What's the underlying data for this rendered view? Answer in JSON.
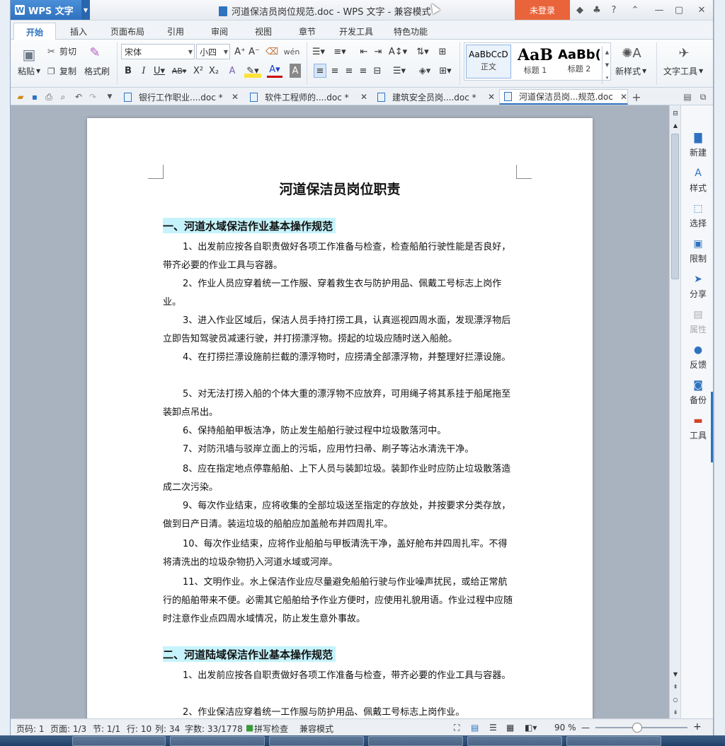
{
  "app": {
    "name": "WPS 文字",
    "doc_title": "河道保洁员岗位规范.doc - WPS 文字 - 兼容模式",
    "login": "未登录"
  },
  "ribbon_tabs": [
    "开始",
    "插入",
    "页面布局",
    "引用",
    "审阅",
    "视图",
    "章节",
    "开发工具",
    "特色功能"
  ],
  "ribbon": {
    "paste": "粘贴",
    "cut": "剪切",
    "copy": "复制",
    "format_painter": "格式刷",
    "font_name": "宋体",
    "font_size": "小四",
    "styles": [
      {
        "sample": "AaBbCcD",
        "name": "正文"
      },
      {
        "sample": "AaB",
        "name": "标题 1"
      },
      {
        "sample": "AaBb(",
        "name": "标题 2"
      }
    ],
    "new_style": "新样式",
    "text_tools": "文字工具"
  },
  "doc_tabs": [
    {
      "label": "银行工作职业....doc *"
    },
    {
      "label": "软件工程师的....doc *"
    },
    {
      "label": "建筑安全员岗....doc *"
    },
    {
      "label": "河道保洁员岗...规范.doc"
    }
  ],
  "document": {
    "title": "河道保洁员岗位职责",
    "section1": "一、河道水域保洁作业基本操作规范",
    "paras1": [
      "1、出发前应按各自职责做好各项工作准备与检查，检查船舶行驶性能是否良好，带齐必要的作业工具与容器。",
      "2、作业人员应穿着统一工作服、穿着救生衣与防护用品、佩戴工号标志上岗作业。",
      "3、进入作业区域后，保洁人员手持打捞工具，认真巡视四周水面，发现漂浮物后立即告知驾驶员减速行驶，并打捞漂浮物。捞起的垃圾应随时送入船舱。",
      "4、在打捞拦漂设施前拦截的漂浮物时，应捞清全部漂浮物，并整理好拦漂设施。",
      "5、对无法打捞入船的个体大重的漂浮物不应放弃，可用绳子将其系挂于船尾拖至装卸点吊出。",
      "6、保持船舶甲板洁净，防止发生船舶行驶过程中垃圾散落河中。",
      "7、对防汛墙与驳岸立面上的污垢，应用竹扫帚、刷子等沾水清洗干净。",
      "8、应在指定地点停靠船舶、上下人员与装卸垃圾。装卸作业时应防止垃圾散落造成二次污染。",
      "9、每次作业结束，应将收集的全部垃圾送至指定的存放处，并按要求分类存放，做到日产日清。装运垃圾的船舶应加盖舱布并四周扎牢。",
      "10、每次作业结束，应将作业船舶与甲板清洗干净，盖好舱布并四周扎牢。不得将清洗出的垃圾杂物扔入河道水域或河岸。",
      "11、文明作业。水上保洁作业应尽量避免船舶行驶与作业噪声扰民，或给正常航行的船舶带来不便。必需其它船舶给予作业方便时，应使用礼貌用语。作业过程中应随时注意作业点四周水域情况，防止发生意外事故。"
    ],
    "section2": "二、河道陆域保洁作业基本操作规范",
    "paras2": [
      "1、出发前应按各自职责做好各项工作准备与检查，带齐必要的作业工具与容器。",
      "2、作业保洁应穿着统一工作服与防护用品、佩戴工号标志上岗作业。"
    ]
  },
  "right_pane": [
    {
      "label": "新建",
      "icon": "new-doc-icon",
      "glyph": "▇"
    },
    {
      "label": "样式",
      "icon": "style-icon",
      "glyph": "A"
    },
    {
      "label": "选择",
      "icon": "select-icon",
      "glyph": "⬚"
    },
    {
      "label": "限制",
      "icon": "restrict-icon",
      "glyph": "▣"
    },
    {
      "label": "分享",
      "icon": "share-icon",
      "glyph": "➤"
    },
    {
      "label": "属性",
      "icon": "properties-icon",
      "glyph": "▤"
    },
    {
      "label": "反馈",
      "icon": "feedback-icon",
      "glyph": "●"
    },
    {
      "label": "备份",
      "icon": "backup-icon",
      "glyph": "◙"
    },
    {
      "label": "工具",
      "icon": "toolbox-icon",
      "glyph": "▬"
    }
  ],
  "status": {
    "page": "页码: 1",
    "pages": "页面: 1/3",
    "section": "节: 1/1",
    "line": "行: 10",
    "column": "列: 34",
    "words": "字数: 33/1778",
    "spellcheck": "拼写检查",
    "compat": "兼容模式",
    "zoom": "90 %"
  },
  "colors": {
    "accent": "#2f72c0",
    "login": "#e9643a",
    "heading_highlight": "#c6f3fb"
  }
}
